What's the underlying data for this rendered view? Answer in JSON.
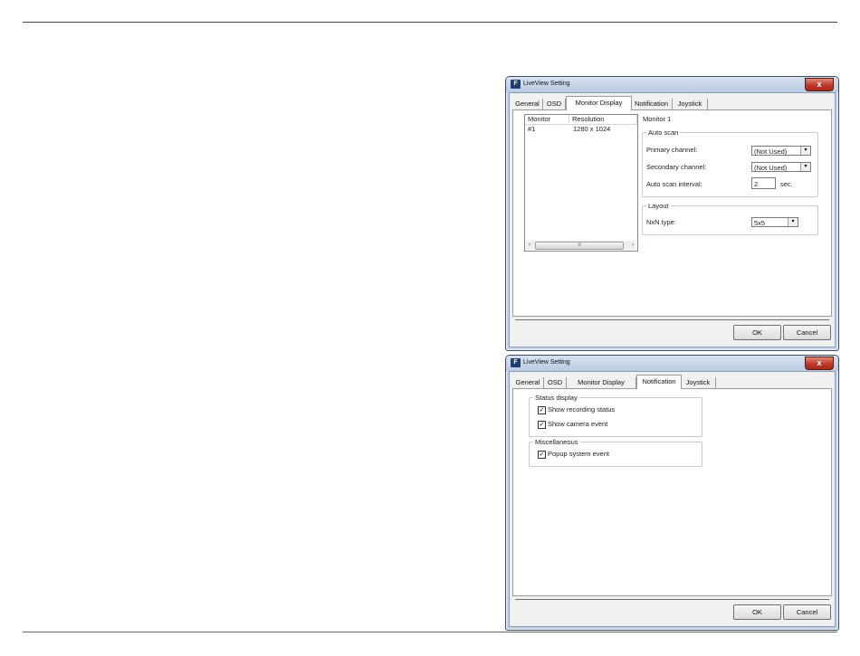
{
  "window1": {
    "title": "LiveView Setting",
    "icon_glyph": "F",
    "close_glyph": "x",
    "tabs": [
      "General",
      "OSD",
      "Monitor Display",
      "Notification",
      "Joystick"
    ],
    "active_tab": "Monitor Display",
    "monitor_list": {
      "columns": [
        "Monitor",
        "Resolution"
      ],
      "rows": [
        {
          "monitor": "#1",
          "resolution": "1280 x 1024"
        }
      ],
      "scroll_left": "‹",
      "scroll_right": "›",
      "scroll_grip": "≡"
    },
    "monitor_title": "Monitor 1",
    "auto_scan": {
      "title": "Auto scan",
      "primary_label": "Primary channel:",
      "primary_value": "(Not Used)",
      "secondary_label": "Secondary channel:",
      "secondary_value": "(Not Used)",
      "interval_label": "Auto scan interval:",
      "interval_value": "2",
      "interval_unit": "sec."
    },
    "layout": {
      "title": "Layout",
      "nxn_label": "NxN type:",
      "nxn_value": "5x5"
    },
    "ok_label": "OK",
    "cancel_label": "Cancel"
  },
  "window2": {
    "title": "LiveView Setting",
    "icon_glyph": "F",
    "close_glyph": "x",
    "tabs": [
      "General",
      "OSD",
      "Monitor Display",
      "Notification",
      "Joystick"
    ],
    "active_tab": "Notification",
    "status_display": {
      "title": "Status display",
      "items": [
        {
          "label": "Show recording status",
          "checked": true
        },
        {
          "label": "Show camera event",
          "checked": true
        }
      ]
    },
    "miscellaneous": {
      "title": "Miscellaneous",
      "items": [
        {
          "label": "Popup system event",
          "checked": true
        }
      ]
    },
    "ok_label": "OK",
    "cancel_label": "Cancel"
  },
  "check_glyph": "✓",
  "dropdown_glyph": "▾"
}
